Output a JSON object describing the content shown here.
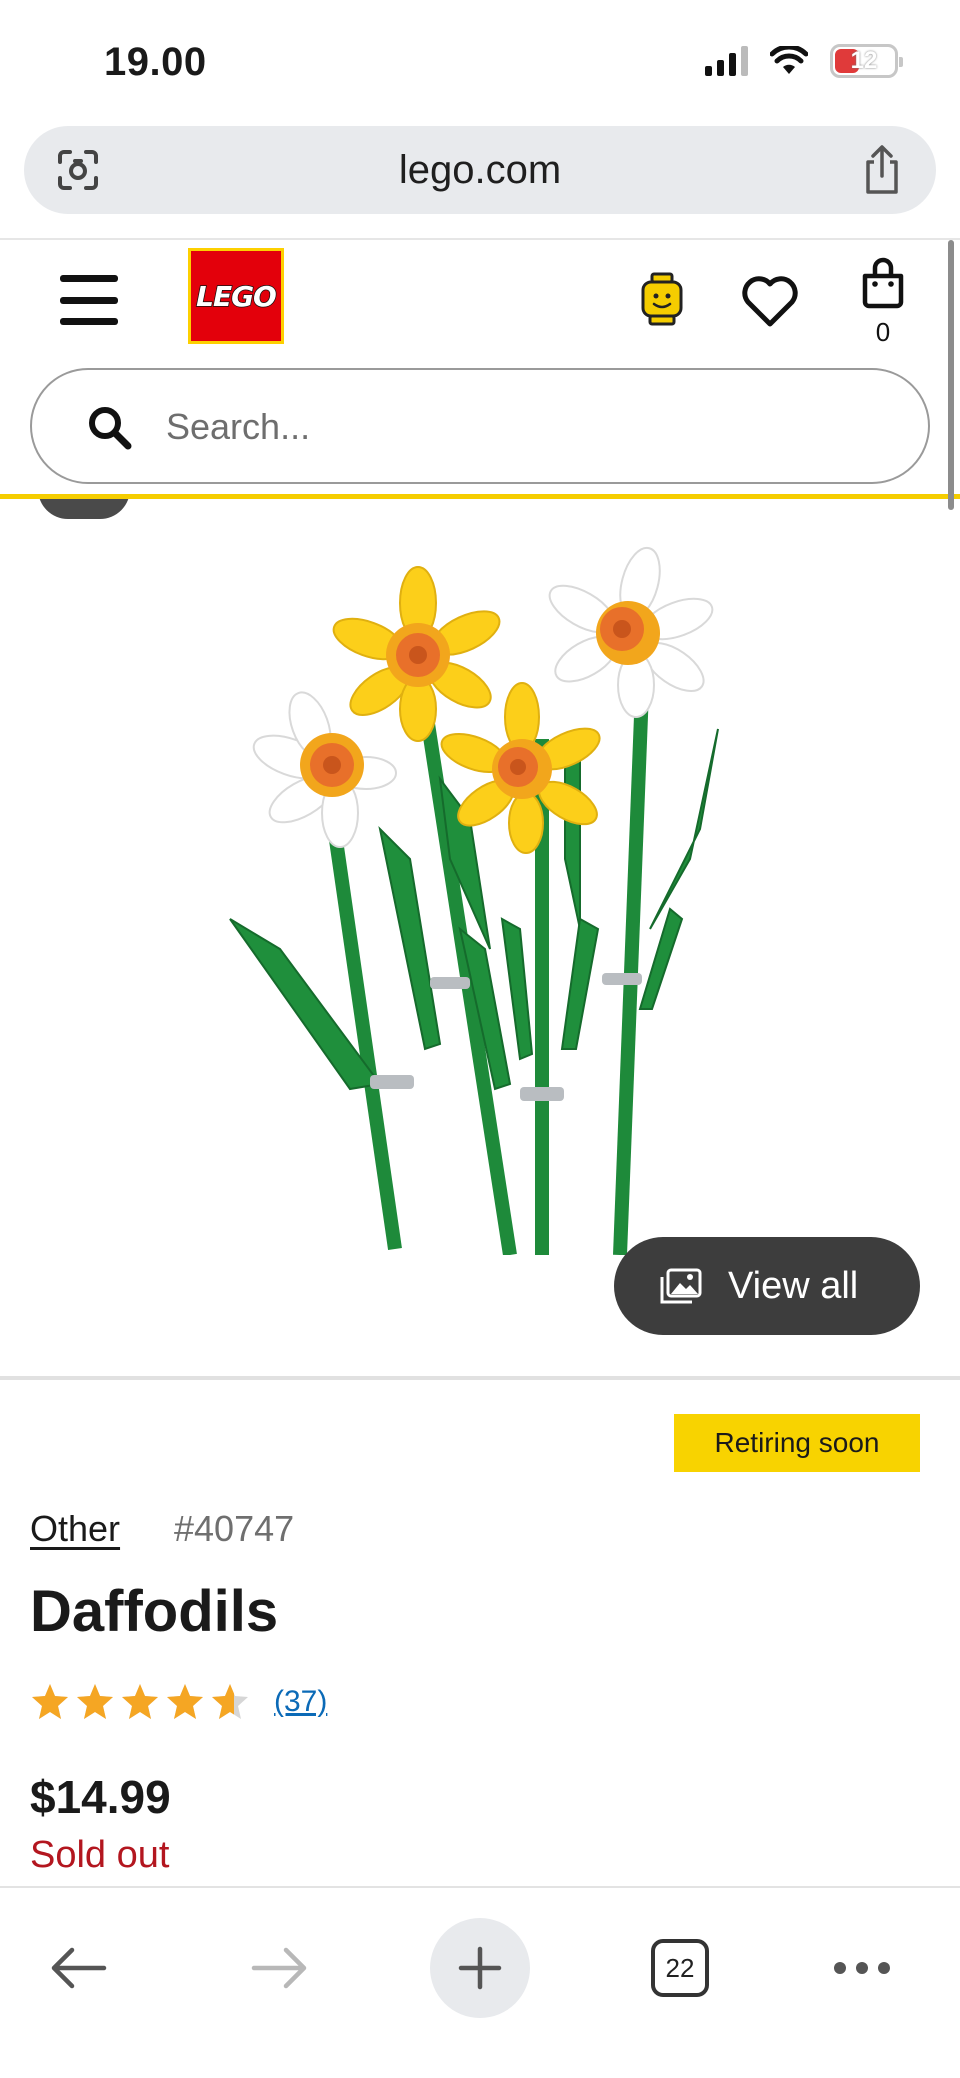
{
  "status_bar": {
    "time": "19.00",
    "battery_level": "12",
    "cellular_bars": 3,
    "icons": [
      "signal-icon",
      "wifi-icon",
      "battery-icon"
    ]
  },
  "browser": {
    "url": "lego.com",
    "open_tab_count": "22",
    "icons": [
      "lens-icon",
      "share-icon",
      "back-icon",
      "forward-icon",
      "new-tab-icon",
      "tabs-icon",
      "more-icon"
    ]
  },
  "header": {
    "logo_text": "LEGO",
    "bag_count": "0",
    "search_placeholder": "Search...",
    "icons": [
      "menu-icon",
      "vip-icon",
      "heart-icon",
      "bag-icon",
      "search-icon"
    ]
  },
  "gallery": {
    "view_all_label": "View all",
    "icons": [
      "gallery-icon"
    ]
  },
  "product": {
    "badge": "Retiring soon",
    "theme": "Other",
    "item_number": "#40747",
    "title": "Daffodils",
    "rating": 4.6,
    "rating_max": 5,
    "review_count": "(37)",
    "price": "$14.99",
    "availability": "Sold out"
  },
  "colors": {
    "lego_red": "#e3000b",
    "lego_yellow": "#f8d300",
    "star": "#f5a623",
    "link_blue": "#0b6ab7",
    "sold_out_red": "#b3161f"
  }
}
